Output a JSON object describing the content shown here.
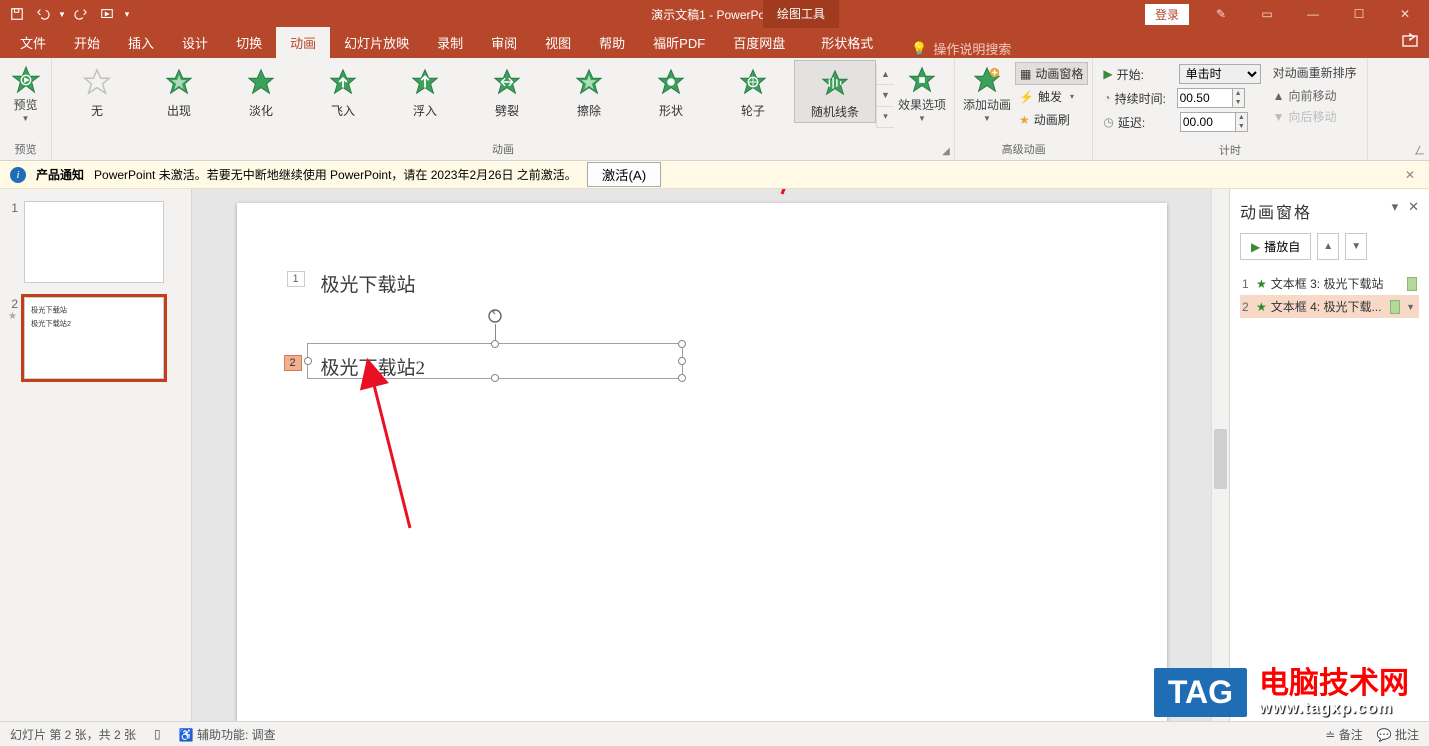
{
  "title": "演示文稿1 - PowerPoint",
  "context_tool": "绘图工具",
  "login": "登录",
  "tabs": {
    "file": "文件",
    "home": "开始",
    "insert": "插入",
    "design": "设计",
    "transitions": "切换",
    "animations": "动画",
    "slideshow": "幻灯片放映",
    "record": "录制",
    "review": "审阅",
    "view": "视图",
    "help": "帮助",
    "foxit": "福昕PDF",
    "baidu": "百度网盘",
    "shape_format": "形状格式",
    "tell_me": "操作说明搜索"
  },
  "ribbon": {
    "preview": "预览",
    "preview_group": "预览",
    "anims": [
      "无",
      "出现",
      "淡化",
      "飞入",
      "浮入",
      "劈裂",
      "擦除",
      "形状",
      "轮子",
      "随机线条"
    ],
    "anim_group": "动画",
    "effect_opts": "效果选项",
    "add_anim": "添加动画",
    "anim_pane": "动画窗格",
    "trigger": "触发",
    "anim_painter": "动画刷",
    "adv_group": "高级动画",
    "start_label": "开始:",
    "start_value": "单击时",
    "duration_label": "持续时间:",
    "duration_value": "00.50",
    "delay_label": "延迟:",
    "delay_value": "00.00",
    "timing_group": "计时",
    "reorder_hdr": "对动画重新排序",
    "move_earlier": "向前移动",
    "move_later": "向后移动"
  },
  "notify": {
    "title": "产品通知",
    "msg": "PowerPoint 未激活。若要无中断地继续使用 PowerPoint，请在 2023年2月26日 之前激活。",
    "action": "激活(A)"
  },
  "slide": {
    "text1": "极光下载站",
    "text2": "极光下载站2",
    "marker1": "1",
    "marker2": "2"
  },
  "anim_pane": {
    "title": "动画窗格",
    "play": "播放自",
    "item1": "文本框 3: 极光下载站",
    "item2": "文本框 4: 极光下载..."
  },
  "status": {
    "slide_info": "幻灯片 第 2 张，共 2 张",
    "access": "辅助功能: 调查",
    "notes": "备注",
    "comments": "批注"
  },
  "watermark": {
    "tag": "TAG",
    "text": "电脑技术网",
    "url": "www.tagxp.com"
  }
}
